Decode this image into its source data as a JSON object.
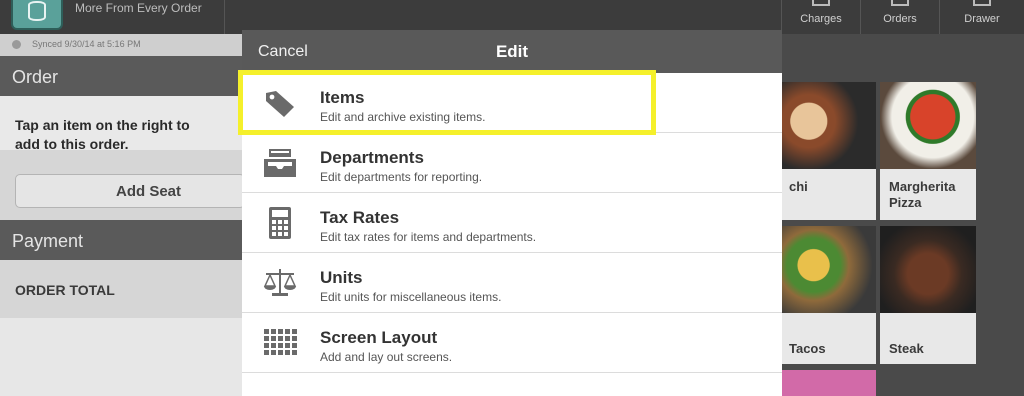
{
  "topbar": {
    "tagline": "More From Every Order",
    "buttons": [
      {
        "label": "Charges",
        "icon": "charges-icon"
      },
      {
        "label": "Orders",
        "icon": "orders-icon"
      },
      {
        "label": "Drawer",
        "icon": "drawer-icon"
      }
    ]
  },
  "left_panel": {
    "sync_status": "Synced 9/30/14 at 5:16 PM",
    "order_heading": "Order",
    "hint": "Tap an item on the right to add to this order.",
    "add_seat": "Add Seat",
    "payment_heading": "Payment",
    "order_total": "ORDER TOTAL"
  },
  "tiles": [
    {
      "name": "chi",
      "photo": "pasta-dish"
    },
    {
      "name": "Margherita Pizza",
      "photo": "margherita-pizza"
    },
    {
      "name": "Tacos",
      "photo": "tacos"
    },
    {
      "name": "Steak",
      "photo": "steak"
    }
  ],
  "modal": {
    "cancel": "Cancel",
    "title": "Edit",
    "items": [
      {
        "title": "Items",
        "subtitle": "Edit and archive existing items.",
        "icon": "tag-icon"
      },
      {
        "title": "Departments",
        "subtitle": "Edit departments for reporting.",
        "icon": "inbox-tray-icon"
      },
      {
        "title": "Tax Rates",
        "subtitle": "Edit tax rates for items and departments.",
        "icon": "calculator-icon"
      },
      {
        "title": "Units",
        "subtitle": "Edit units for miscellaneous items.",
        "icon": "scale-icon"
      },
      {
        "title": "Screen Layout",
        "subtitle": "Add and lay out screens.",
        "icon": "grid-icon"
      }
    ]
  },
  "colors": {
    "highlight": "#f5f02b",
    "modal_header": "#595959",
    "topbar": "#3c3c3c",
    "logo": "#5aa19a"
  }
}
